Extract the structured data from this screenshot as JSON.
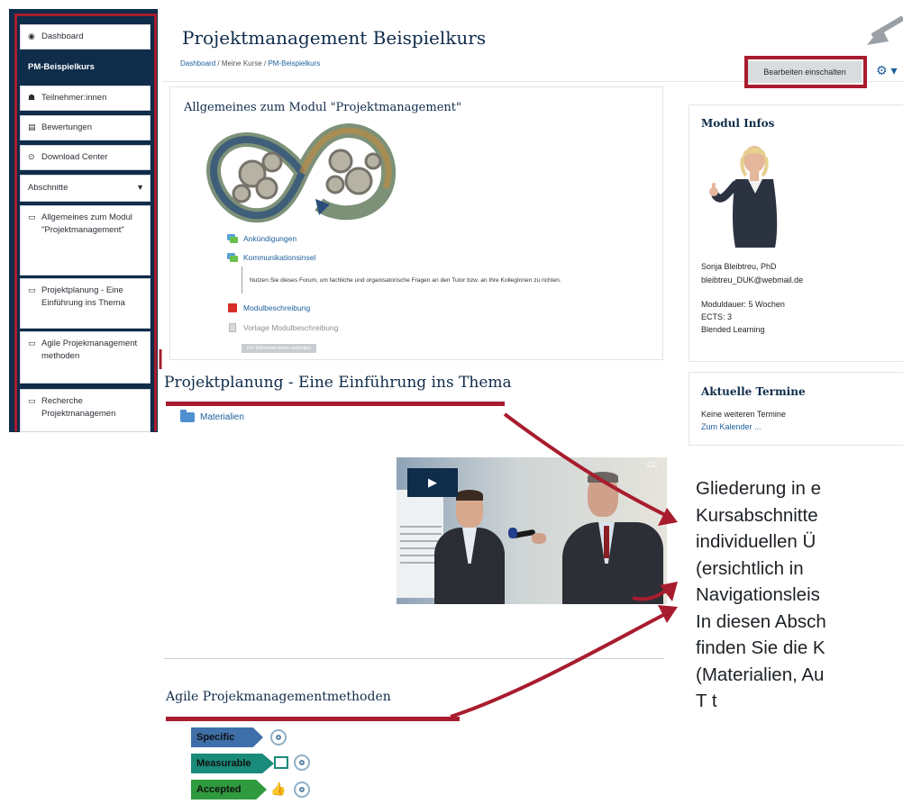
{
  "sidebar": {
    "items": [
      {
        "label": "Dashboard",
        "icon": "tachometer-icon"
      },
      {
        "label": "PM-Beispielkurs",
        "icon": ""
      },
      {
        "label": "Teilnehmer:innen",
        "icon": "users-icon"
      },
      {
        "label": "Bewertungen",
        "icon": "table-icon"
      },
      {
        "label": "Download Center",
        "icon": "download-icon"
      },
      {
        "label": "Abschnitte",
        "icon": "caret-down-icon"
      },
      {
        "label": "Allgemeines zum Modul \"Projektmanagement\"",
        "icon": "folder-outline-icon"
      },
      {
        "label": "Projektplanung - Eine Einführung ins Thema",
        "icon": "folder-outline-icon"
      },
      {
        "label": "Agile Projekmanagement methoden",
        "icon": "folder-outline-icon"
      },
      {
        "label": "Recherche Projektmanagemen",
        "icon": "folder-outline-icon"
      }
    ]
  },
  "header": {
    "title": "Projektmanagement Beispielkurs",
    "breadcrumb": [
      "Dashboard",
      "Meine Kurse",
      "PM-Beispielkurs"
    ],
    "edit_button": "Bearbeiten einschalten",
    "gear_icon": "gear-icon"
  },
  "sections": {
    "general": {
      "title": "Allgemeines zum Modul \"Projektmanagement\"",
      "activities": [
        {
          "label": "Ankündigungen",
          "icon": "forum-icon"
        },
        {
          "label": "Kommunikationsinsel",
          "icon": "forum-icon"
        },
        {
          "label": "Modulbeschreibung",
          "icon": "pdf-icon"
        },
        {
          "label": "Vorlage Modulbeschreibung",
          "icon": "file-icon"
        }
      ],
      "forum_description": "Nutzen Sie dieses Forum, um fachliche und organisatorische Fragen an den Tutor bzw. an Ihre KollegInnen zu richten.",
      "hidden_badge": "Für Teilnehmer:innen verborgen"
    },
    "planning": {
      "title": "Projektplanung - Eine Einführung ins Thema",
      "folder": "Materialien"
    },
    "agile": {
      "title": "Agile Projekmanagementmethoden",
      "smart": [
        "Specific",
        "Measurable",
        "Accepted"
      ]
    }
  },
  "video": {
    "play_icon": "play-icon",
    "cc_label": "CC"
  },
  "blocks": {
    "modul_infos": {
      "title": "Modul Infos",
      "name": "Sonja Bleibtreu, PhD",
      "email": "bleibtreu_DUK@webmail.de",
      "duration": "Moduldauer: 5 Wochen",
      "ects": "ECTS: 3",
      "format": "Blended Learning"
    },
    "termine": {
      "title": "Aktuelle Termine",
      "none": "Keine weiteren Termine",
      "calendar_link": "Zum Kalender ..."
    }
  },
  "callout": {
    "lines": [
      "Gliederung in e",
      "Kursabschnitte",
      "individuellen Ü",
      "(ersichtlich in",
      "Navigationsleis",
      "In diesen Absch",
      "finden Sie die K",
      "(Materialien, Au",
      "T t"
    ]
  },
  "colors": {
    "navy": "#0f2c4a",
    "highlight": "#a81c2e",
    "link": "#1d5f9e"
  }
}
